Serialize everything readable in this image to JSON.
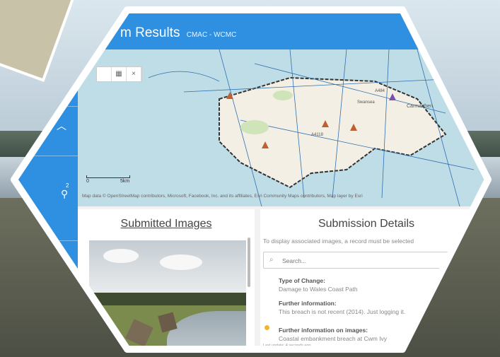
{
  "header": {
    "title": "m Results",
    "subtitle": "CMAC - WCMC"
  },
  "map": {
    "toolbar": [
      "",
      "▦",
      "×"
    ],
    "scale_left": "0",
    "scale_right": "5km",
    "attribution": "Map data © OpenStreetMap contributors, Microsoft, Facebook, Inc. and its affiliates, Esri Community Maps contributors, Map layer by Esri",
    "labels": [
      "A4118",
      "A484",
      "Carmarthen",
      "Swansea"
    ]
  },
  "submitted_images": {
    "title": "Submitted Images"
  },
  "submission_details": {
    "title": "Submission Details",
    "hint": "To display associated images, a record must be selected",
    "search_placeholder": "Search...",
    "fields": [
      {
        "label": "Type of Change:",
        "value": "Damage to Wales Coast Path"
      },
      {
        "label": "Further information:",
        "value": "This breach is not recent (2014). Just logging it."
      },
      {
        "label": "Further information on images:",
        "value": "Coastal embankment breach at Cwm Ivy"
      }
    ],
    "last_update": "Last update: 4 seconds ago"
  },
  "sidebar": {
    "badge": "2"
  },
  "colors": {
    "header_blue": "#2f8fe0",
    "accent_dot": "#f2b530",
    "frame": "#ffffff"
  }
}
